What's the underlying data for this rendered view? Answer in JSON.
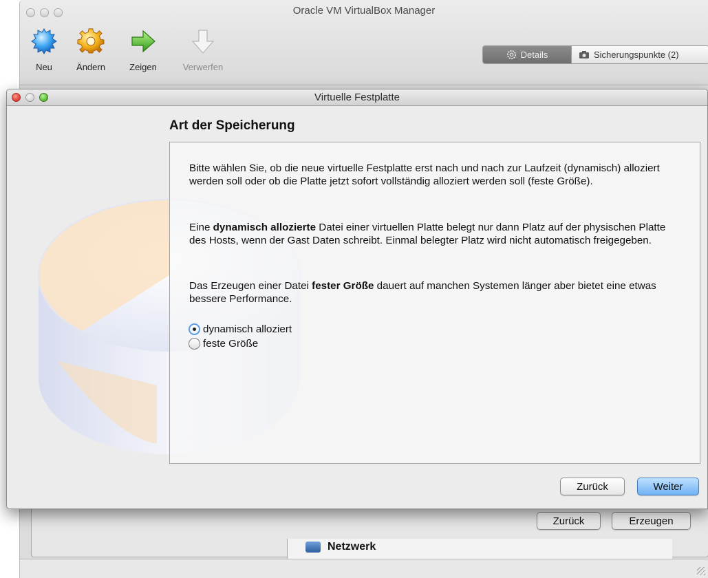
{
  "main_window": {
    "title": "Oracle VM VirtualBox Manager",
    "toolbar": [
      {
        "label": "Neu",
        "icon": "new-machine-icon",
        "enabled": true
      },
      {
        "label": "Ändern",
        "icon": "settings-gear-icon",
        "enabled": true
      },
      {
        "label": "Zeigen",
        "icon": "show-arrow-icon",
        "enabled": true
      },
      {
        "label": "Verwerfen",
        "icon": "discard-arrow-icon",
        "enabled": false
      }
    ],
    "segments": {
      "details": "Details",
      "snapshots": "Sicherungspunkte (2)"
    },
    "background_buttons": {
      "back": "Zurück",
      "create": "Erzeugen"
    },
    "details_section": "Netzwerk"
  },
  "dialog": {
    "title": "Virtuelle Festplatte",
    "heading": "Art der Speicherung",
    "paragraph1": "Bitte wählen Sie, ob die neue virtuelle Festplatte erst nach und nach zur Laufzeit (dynamisch) alloziert werden soll oder ob die Platte jetzt sofort vollständig alloziert werden soll (feste Größe).",
    "paragraph2": {
      "before": "Eine ",
      "bold": "dynamisch allozierte",
      "after": " Datei einer virtuellen Platte belegt nur dann Platz auf der physischen Platte des Hosts, wenn der Gast Daten schreibt. Einmal belegter Platz wird nicht automatisch freigegeben."
    },
    "paragraph3": {
      "before": "Das Erzeugen einer Datei ",
      "bold": "fester Größe",
      "after": " dauert auf manchen Systemen länger aber bietet eine etwas bessere Performance."
    },
    "options": [
      {
        "label": "dynamisch alloziert",
        "selected": true
      },
      {
        "label": "feste Größe",
        "selected": false
      }
    ],
    "buttons": {
      "back": "Zurück",
      "next": "Weiter"
    }
  },
  "colors": {
    "default_button": "#6fb2f4",
    "radio_focus": "#5b9de0",
    "close_red": "#e0443a",
    "zoom_green": "#61c23b"
  }
}
